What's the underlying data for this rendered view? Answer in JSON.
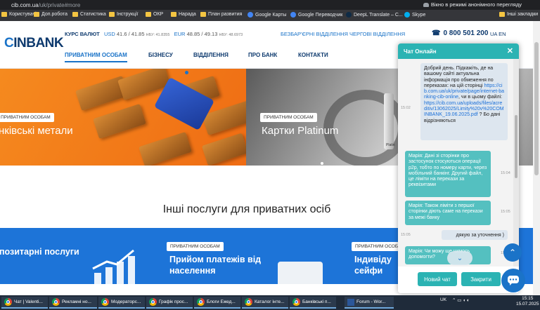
{
  "browser": {
    "url_host": "cib.com.ua",
    "url_path": "/uk/private#more",
    "incognito_label": "Вікно в режимі анонімного перегляду",
    "bookmarks": [
      {
        "label": "Користувачі",
        "icon": "folder-icon"
      },
      {
        "label": "Доп.робота",
        "icon": "folder-icon"
      },
      {
        "label": "Статистика",
        "icon": "folder-icon"
      },
      {
        "label": "Інструкції",
        "icon": "folder-icon"
      },
      {
        "label": "ОКР",
        "icon": "folder-icon"
      },
      {
        "label": "Нарада",
        "icon": "folder-icon"
      },
      {
        "label": "План развития",
        "icon": "folder-icon"
      },
      {
        "label": "Google Карты",
        "icon": "google-maps-icon"
      },
      {
        "label": "Google Переводчик",
        "icon": "google-translate-icon"
      },
      {
        "label": "DeepL Translate – C...",
        "icon": "deepl-icon"
      },
      {
        "label": "Skype",
        "icon": "skype-icon"
      }
    ],
    "other_bookmarks": "Інші закладки"
  },
  "header": {
    "logo_text": "INBANK",
    "rates_label": "КУРС ВАЛЮТ",
    "usd": {
      "code": "USD",
      "value": "41.6 / 41.85",
      "nbu": "НБУ: 41.8355"
    },
    "eur": {
      "code": "EUR",
      "value": "48.85 / 49.13",
      "nbu": "НБУ: 48.6973"
    },
    "link_branch": "БЕЗБАР'ЄРНІ ВІДДІЛЕННЯ",
    "link_duty": "ЧЕРГОВІ ВІДДІЛЕННЯ",
    "phone": "0 800 501 200",
    "lang": "UA  EN",
    "nav": [
      "ПРИВАТНИМ ОСОБАМ",
      "БІЗНЕСУ",
      "ВІДДІЛЕННЯ",
      "ПРО БАНК",
      "КОНТАКТИ"
    ]
  },
  "banners": [
    {
      "tag": "ПРИВАТНИМ ОСОБАМ",
      "title": "нківські метали"
    },
    {
      "tag": "ПРИВАТНИМ ОСОБАМ",
      "title": "Картки Platinum",
      "card_text": "Platin"
    }
  ],
  "section_title": "Інші послуги для приватних осіб",
  "service_cards": [
    {
      "tag": "",
      "title": "позитарні послуги"
    },
    {
      "tag": "ПРИВАТНИМ ОСОБАМ",
      "title": "Прийом платежів від населення"
    },
    {
      "tag": "ПРИВАТНИМ ОСОБАМ",
      "title": "Індивіду сейфи"
    }
  ],
  "chat": {
    "title": "Чат Онлайн",
    "messages": [
      {
        "from": "user",
        "text_before": "Добрий день. Підкажіть, де на вашому сайті актуальна інформація про обмеження по переказах: на цій сторінці ",
        "link1": "https://cib.com.ua/uk/private/page/internet-banking-cib-online",
        "text_mid": ", чи в цьому файлі: ",
        "link2": "https://cib.com.ua/uploads/files/acreditiv/13062025/Limity%20v%20COMINBANK_19.06.2025.pdf",
        "text_after": " ? Бо дані відрізняються",
        "time": "15:02"
      },
      {
        "from": "agent",
        "text": "Марія: Дані зі сторінки про застосунок стосуються операції p2p, тобто по номеру карти, через мобільний банкінг. Другий файл, це ліміти на перекази за реквізитами",
        "time": "15:04"
      },
      {
        "from": "agent",
        "text": "Марія: Також ліміти з першої сторінки діють саме на перекази за межі банку",
        "time": "15:05"
      },
      {
        "from": "user",
        "text": "дякую за уточнення )",
        "time": "15:05"
      },
      {
        "from": "agent",
        "text": "Марія: Чи можу ще чимось допомогти?",
        "time": "15:05"
      }
    ],
    "new_chat_label": "Новий чат",
    "close_label": "Закрити"
  },
  "taskbar": {
    "items": [
      {
        "label": "Чат | Valenti..."
      },
      {
        "label": "Рекламні но..."
      },
      {
        "label": "Модераторс..."
      },
      {
        "label": "Графік прос..."
      },
      {
        "label": "Блоги Ежед..."
      },
      {
        "label": "Каталог інте..."
      },
      {
        "label": "Банківські п..."
      },
      {
        "label": "Forum - Wor..."
      }
    ],
    "lang": "UK",
    "time": "15:15",
    "date": "15.07.2025"
  },
  "colors": {
    "brand_dark": "#0e3a6e",
    "brand_blue": "#1a73c8",
    "chat_teal": "#2bb3b3",
    "banner_orange": "#f58a1f"
  }
}
